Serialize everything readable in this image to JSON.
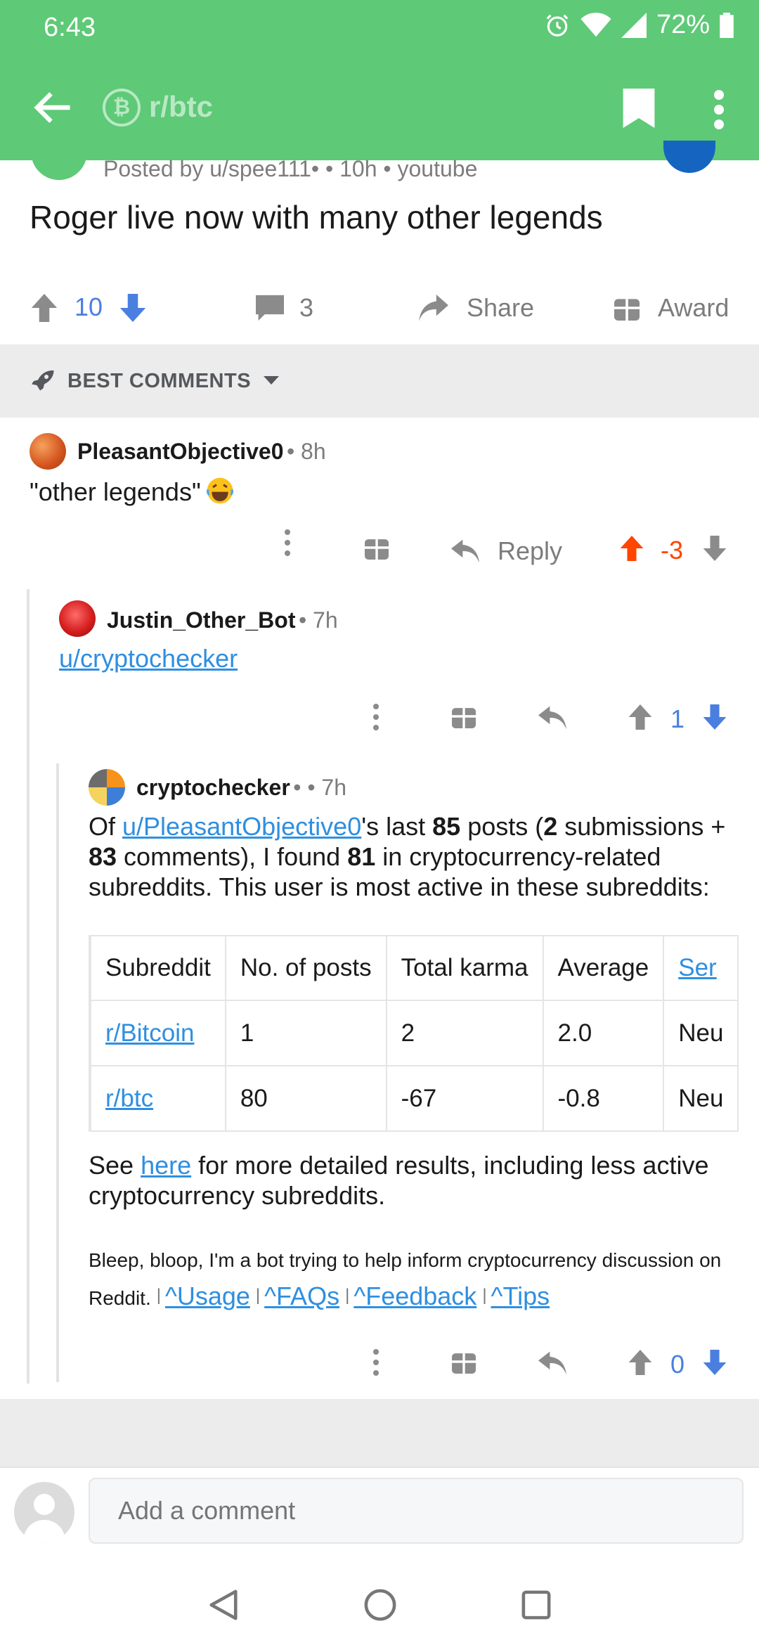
{
  "status_bar": {
    "time": "6:43",
    "battery": "72%"
  },
  "app_bar": {
    "subreddit": "r/btc",
    "subreddit_icon": "bitcoin-icon"
  },
  "post": {
    "meta": "Posted by u/spee111• • 10h • youtube",
    "title": "Roger live now with many other legends",
    "score": "10",
    "comments": "3",
    "share_label": "Share",
    "award_label": "Award"
  },
  "sort": {
    "label": "BEST COMMENTS"
  },
  "comments": [
    {
      "author": "PleasantObjective0",
      "time": "• 8h",
      "body": "\"other legends\"",
      "reply_label": "Reply",
      "score": "-3",
      "score_color": "#ff4500"
    },
    {
      "author": "Justin_Other_Bot",
      "time": "• 7h",
      "link": "u/cryptochecker",
      "score": "1"
    },
    {
      "author": "cryptochecker",
      "time": "• • 7h",
      "body": {
        "p1": "Of ",
        "user_link": "u/PleasantObjective0",
        "p2": "'s last ",
        "n1": "85",
        "p3": " posts (",
        "n2": "2",
        "p4": " submissions + ",
        "n3": "83",
        "p5": " comments), I found ",
        "n4": "81",
        "p6": " in cryptocurrency-related subreddits. This user is most active in these subreddits:"
      },
      "table": {
        "headers": [
          "Subreddit",
          "No. of posts",
          "Total karma",
          "Average",
          "Ser"
        ],
        "rows": [
          [
            "r/Bitcoin",
            "1",
            "2",
            "2.0",
            "Neu"
          ],
          [
            "r/btc",
            "80",
            "-67",
            "-0.8",
            "Neu"
          ]
        ]
      },
      "see": {
        "p1": "See ",
        "link": "here",
        "p2": " for more detailed results, including less active cryptocurrency subreddits."
      },
      "bot_note": "Bleep, bloop, I'm a bot trying to help inform cryptocurrency discussion on Reddit.",
      "bot_links": [
        "^Usage",
        "^FAQs",
        "^Feedback",
        "^Tips"
      ],
      "score": "0"
    }
  ],
  "composer": {
    "placeholder": "Add a comment"
  },
  "colors": {
    "brand_green": "#5ec977",
    "upvote": "#ff4500",
    "downvote": "#4a7fe0",
    "link": "#2f8fe0"
  }
}
